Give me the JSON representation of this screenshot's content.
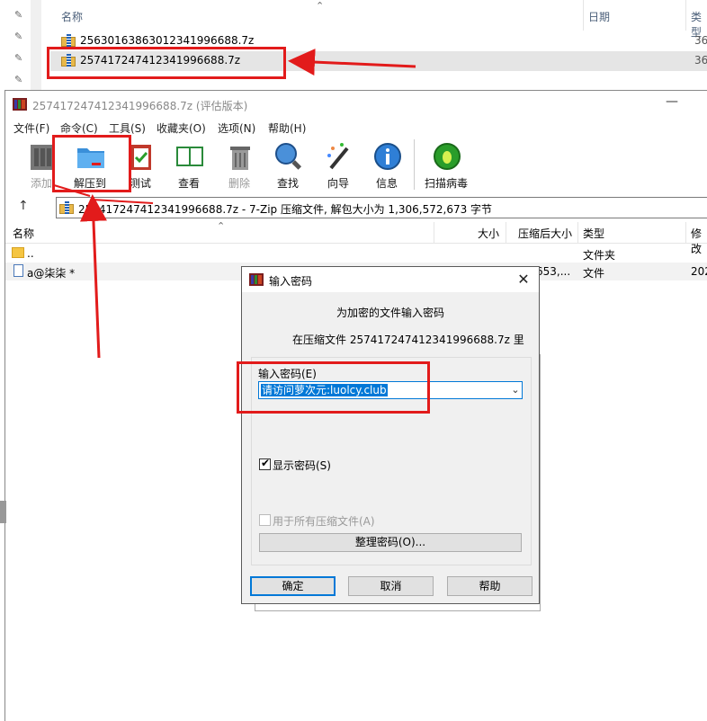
{
  "explorer": {
    "columns": {
      "name": "名称",
      "date": "日期",
      "type": "类型"
    },
    "files": [
      {
        "name": "25630163863012341996688.7z",
        "size": "36"
      },
      {
        "name": "257417247412341996688.7z",
        "size": "36"
      }
    ]
  },
  "window": {
    "title": "257417247412341996688.7z (评估版本)",
    "minimize": "—"
  },
  "menu": [
    "文件(F)",
    "命令(C)",
    "工具(S)",
    "收藏夹(O)",
    "选项(N)",
    "帮助(H)"
  ],
  "toolbar": {
    "add": "添加",
    "extract": "解压到",
    "test": "测试",
    "view": "查看",
    "delete": "删除",
    "find": "查找",
    "wizard": "向导",
    "info": "信息",
    "virus_scan": "扫描病毒"
  },
  "address": {
    "up": "↑",
    "text": "257417247412341996688.7z - 7-Zip 压缩文件, 解包大小为 1,306,572,673 字节"
  },
  "list": {
    "columns": {
      "name": "名称",
      "size": "大小",
      "packed": "压缩后大小",
      "type": "类型",
      "modified": "修改"
    },
    "rows": [
      {
        "name": "..",
        "size": "",
        "packed": "",
        "type": "文件夹",
        "modified": ""
      },
      {
        "name": "a@柒柒 *",
        "size": "",
        "packed": "653,...",
        "type": "文件",
        "modified": "202"
      }
    ]
  },
  "dialog": {
    "title": "输入密码",
    "heading": "为加密的文件输入密码",
    "subtitle": "在压缩文件 257417247412341996688.7z 里",
    "password_label": "输入密码(E)",
    "password_value": "请访问萝次元:luolcy.club",
    "show_password": "显示密码(S)",
    "show_password_checked": true,
    "all_archives": "用于所有压缩文件(A)",
    "all_archives_checked": false,
    "organize": "整理密码(O)...",
    "ok": "确定",
    "cancel": "取消",
    "help": "帮助"
  },
  "colors": {
    "annotation_red": "#e21b1b",
    "selection_blue": "#0078d7"
  }
}
